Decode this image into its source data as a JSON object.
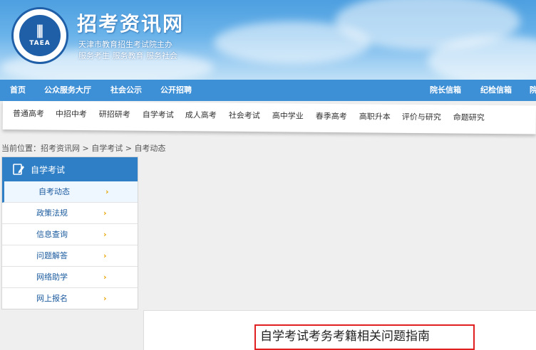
{
  "header": {
    "logo_abbr": "TAEA",
    "site_title": "招考资讯网",
    "org_name": "天津市教育招生考试院主办",
    "slogan": "服务考生 服务教育 服务社会"
  },
  "nav_primary": [
    {
      "label": "首页"
    },
    {
      "label": "公众服务大厅"
    },
    {
      "label": "社会公示"
    },
    {
      "label": "公开招聘"
    },
    {
      "label": "院长信箱"
    },
    {
      "label": "纪检信箱"
    },
    {
      "label": "院"
    }
  ],
  "nav_secondary": [
    {
      "label": "普通高考"
    },
    {
      "label": "中招中考"
    },
    {
      "label": "研招研考"
    },
    {
      "label": "自学考试"
    },
    {
      "label": "成人高考"
    },
    {
      "label": "社会考试"
    },
    {
      "label": "高中学业"
    },
    {
      "label": "春季高考"
    },
    {
      "label": "高职升本"
    },
    {
      "label": "评价与研究"
    },
    {
      "label": "命题研究"
    }
  ],
  "breadcrumb": {
    "prefix": "当前位置：",
    "items": [
      "招考资讯网",
      "自学考试",
      "自考动态"
    ],
    "separator": " > "
  },
  "sidebar": {
    "title": "自学考试",
    "icon": "pencil-icon",
    "items": [
      {
        "label": "自考动态",
        "active": true
      },
      {
        "label": "政策法规"
      },
      {
        "label": "信息查询"
      },
      {
        "label": "问题解答"
      },
      {
        "label": "网络助学"
      },
      {
        "label": "网上报名"
      }
    ]
  },
  "content": {
    "article_title": "自学考试考务考籍相关问题指南"
  },
  "colors": {
    "nav_primary_bg": "#3d8fd6",
    "sidebar_head_bg": "#2f7fc7",
    "highlight_border": "#e02020",
    "chevron": "#e8a500"
  }
}
